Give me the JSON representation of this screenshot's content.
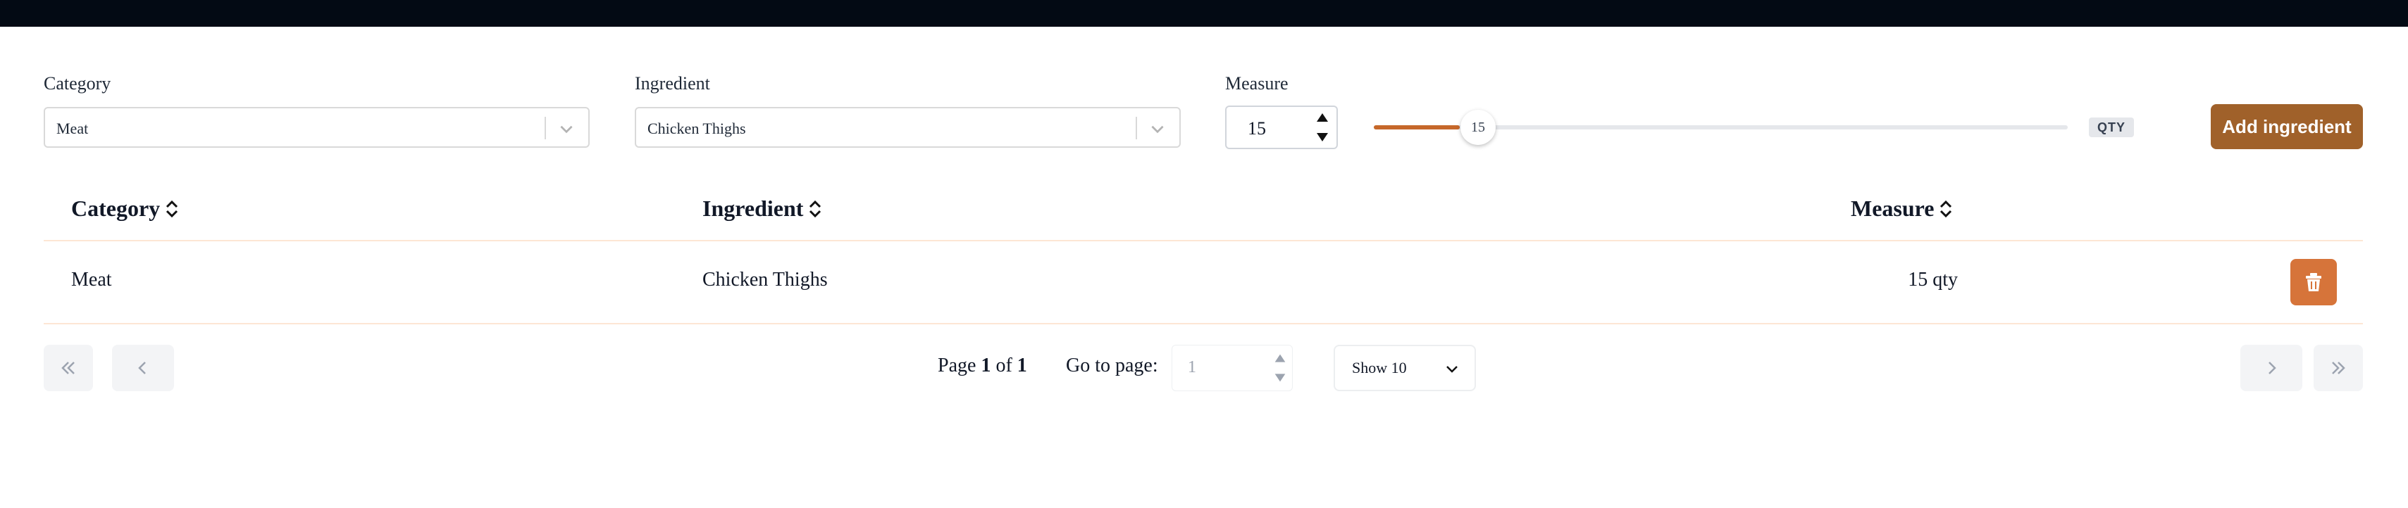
{
  "form": {
    "category_label": "Category",
    "category_value": "Meat",
    "ingredient_label": "Ingredient",
    "ingredient_value": "Chicken Thighs",
    "measure_label": "Measure",
    "measure_value": "15",
    "slider_value": "15",
    "unit_badge": "QTY",
    "add_button": "Add ingredient"
  },
  "table": {
    "headers": [
      "Category",
      "Ingredient",
      "Measure"
    ],
    "rows": [
      {
        "category": "Meat",
        "ingredient": "Chicken Thighs",
        "measure": "15 qty"
      }
    ]
  },
  "pagination": {
    "page_prefix": "Page",
    "current_page": "1",
    "of_text": "of",
    "total_pages": "1",
    "goto_label": "Go to page:",
    "goto_value": "1",
    "page_size": "Show 10"
  },
  "colors": {
    "accent": "#c6682a",
    "button": "#a0612a",
    "topbar": "#030a14"
  }
}
